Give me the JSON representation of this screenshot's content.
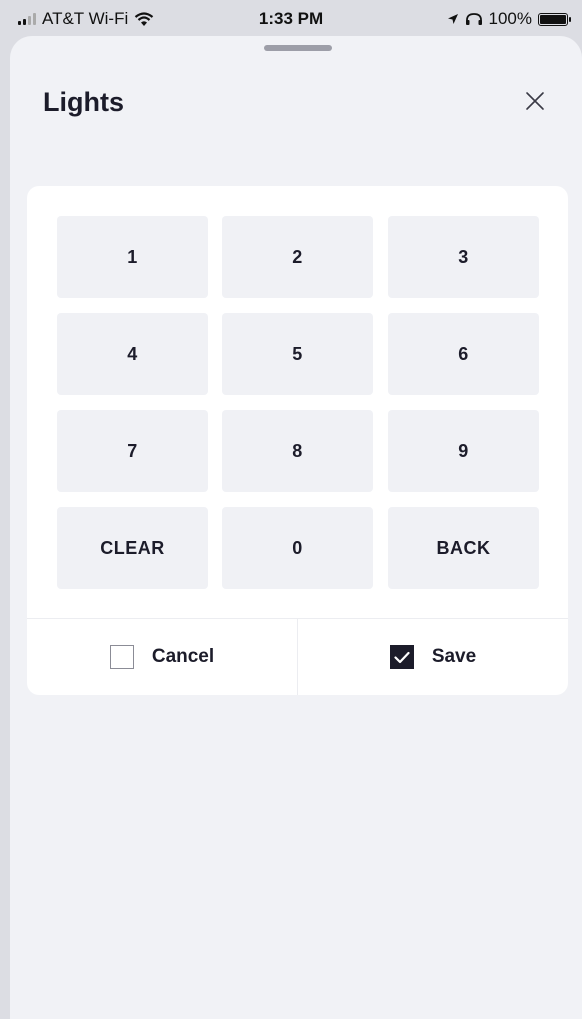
{
  "status_bar": {
    "carrier": "AT&T Wi-Fi",
    "time": "1:33 PM",
    "battery": "100%",
    "icons": [
      "signal-icon",
      "wifi-icon",
      "location-icon",
      "headphones-icon",
      "battery-icon"
    ]
  },
  "sheet": {
    "title": "Lights",
    "close_icon": "close-icon"
  },
  "keypad": {
    "keys": [
      "1",
      "2",
      "3",
      "4",
      "5",
      "6",
      "7",
      "8",
      "9",
      "CLEAR",
      "0",
      "BACK"
    ]
  },
  "actions": {
    "cancel": {
      "label": "Cancel",
      "checked": false
    },
    "save": {
      "label": "Save",
      "checked": true
    }
  },
  "colors": {
    "text": "#1c1c2a",
    "key_background": "#f0f1f5",
    "sheet_background": "#f1f2f6"
  }
}
